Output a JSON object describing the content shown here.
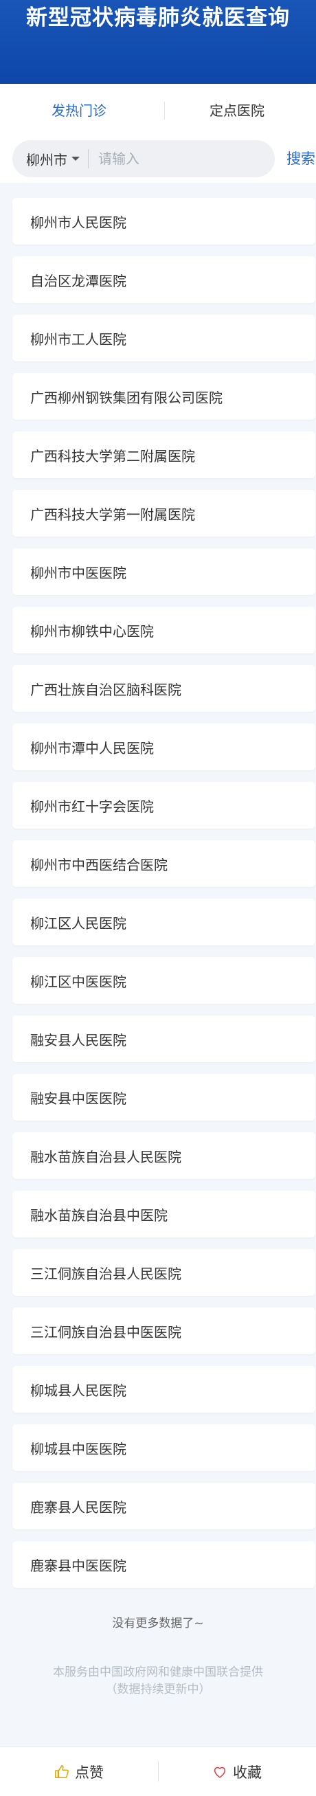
{
  "header": {
    "title": "新型冠状病毒肺炎就医查询"
  },
  "tabs": [
    {
      "label": "发热门诊",
      "active": true
    },
    {
      "label": "定点医院",
      "active": false
    }
  ],
  "search": {
    "city": "柳州市",
    "placeholder": "请输入",
    "value": "",
    "button_label": "搜索"
  },
  "hospitals": [
    "柳州市人民医院",
    "自治区龙潭医院",
    "柳州市工人医院",
    "广西柳州钢铁集团有限公司医院",
    "广西科技大学第二附属医院",
    "广西科技大学第一附属医院",
    "柳州市中医医院",
    "柳州市柳铁中心医院",
    "广西壮族自治区脑科医院",
    "柳州市潭中人民医院",
    "柳州市红十字会医院",
    "柳州市中西医结合医院",
    "柳江区人民医院",
    "柳江区中医医院",
    "融安县人民医院",
    "融安县中医医院",
    "融水苗族自治县人民医院",
    "融水苗族自治县中医院",
    "三江侗族自治县人民医院",
    "三江侗族自治县中医医院",
    "柳城县人民医院",
    "柳城县中医医院",
    "鹿寨县人民医院",
    "鹿寨县中医医院"
  ],
  "list_end_text": "没有更多数据了~",
  "footer": {
    "line1": "本服务由中国政府网和健康中国联合提供",
    "line2": "（数据持续更新中）"
  },
  "bottom_bar": {
    "like_label": "点赞",
    "like_icon": "thumbs-up-icon",
    "favorite_label": "收藏",
    "favorite_icon": "heart-icon"
  },
  "colors": {
    "banner": "#0d47a8",
    "accent": "#2a68c9",
    "favorite": "#e0494a"
  }
}
